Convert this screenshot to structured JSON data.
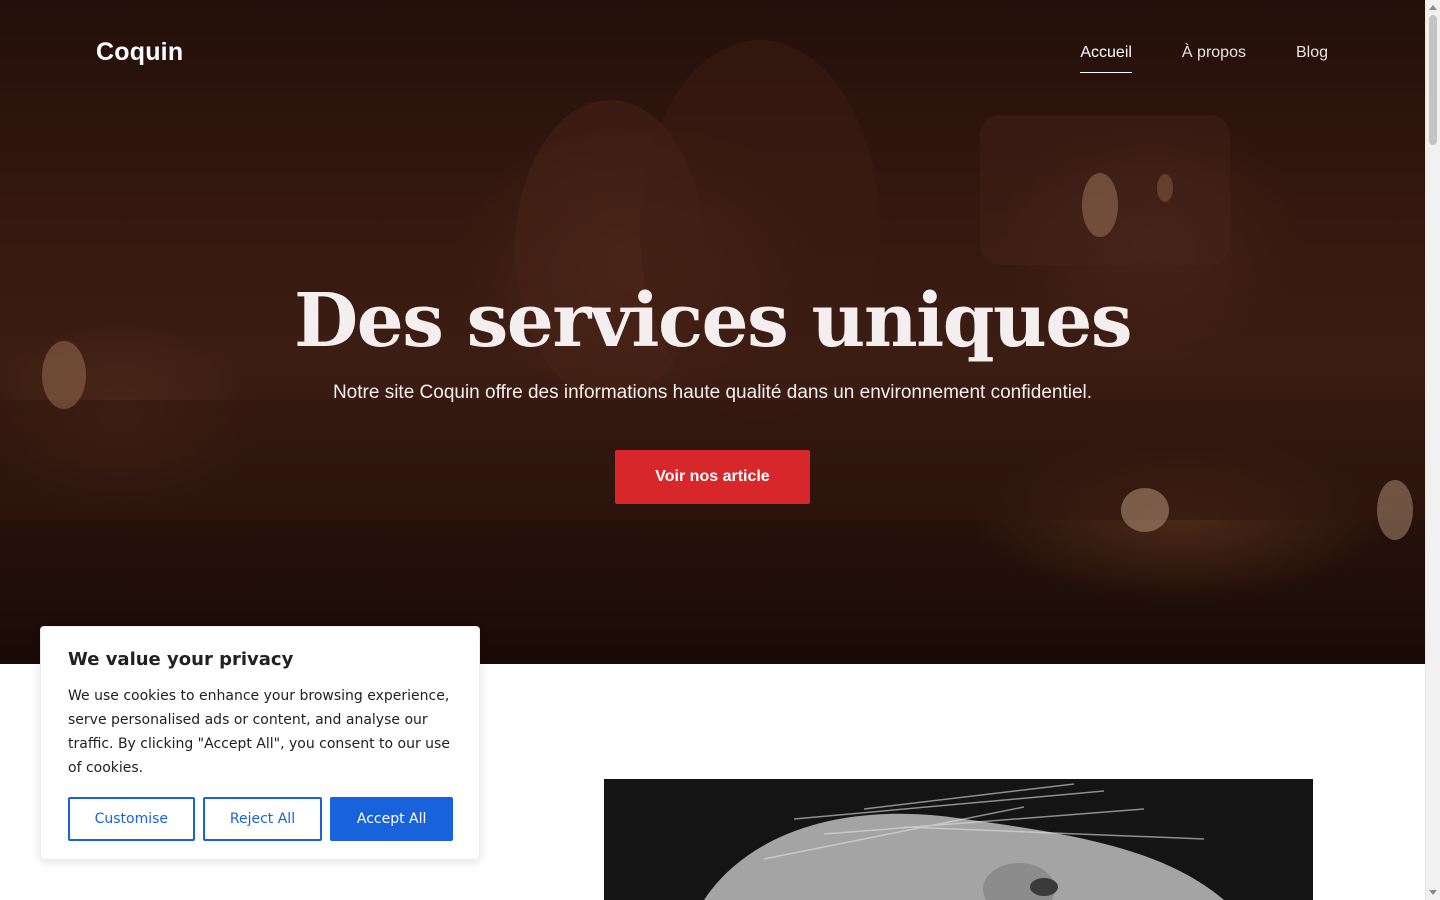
{
  "header": {
    "logo": "Coquin",
    "nav": [
      {
        "label": "Accueil",
        "active": true
      },
      {
        "label": "À propos",
        "active": false
      },
      {
        "label": "Blog",
        "active": false
      }
    ]
  },
  "hero": {
    "title": "Des services uniques",
    "subtitle": "Notre site Coquin offre des informations haute qualité dans un environnement confidentiel.",
    "cta_label": "Voir nos article"
  },
  "cookie_banner": {
    "title": "We value your privacy",
    "text": "We use cookies to enhance your browsing experience, serve personalised ads or content, and analyse our traffic. By clicking \"Accept All\", you consent to our use of cookies.",
    "buttons": {
      "customise": "Customise",
      "reject": "Reject All",
      "accept": "Accept All"
    }
  },
  "colors": {
    "cta": "#d8272b",
    "cookie_accent": "#1863dc",
    "hero_tint": "#3e1d14"
  }
}
